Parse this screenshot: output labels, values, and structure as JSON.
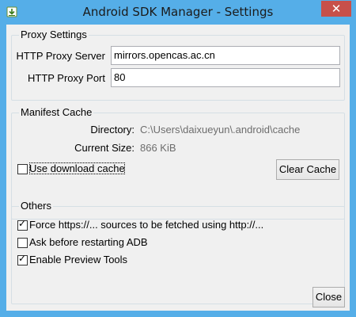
{
  "window": {
    "title": "Android SDK Manager - Settings",
    "close_glyph": "✕"
  },
  "proxy": {
    "group_title": "Proxy Settings",
    "server_label": "HTTP Proxy Server",
    "server_value": "mirrors.opencas.ac.cn",
    "port_label": "HTTP Proxy Port",
    "port_value": "80"
  },
  "manifest": {
    "group_title": "Manifest Cache",
    "directory_label": "Directory:",
    "directory_value": "C:\\Users\\daixueyun\\.android\\cache",
    "size_label": "Current Size:",
    "size_value": "866 KiB",
    "use_cache_label": "Use download cache",
    "use_cache_checked": false,
    "clear_button": "Clear Cache"
  },
  "others": {
    "group_title": "Others",
    "options": [
      {
        "label": "Force https://... sources to be fetched using http://...",
        "checked": true
      },
      {
        "label": "Ask before restarting ADB",
        "checked": false
      },
      {
        "label": "Enable Preview Tools",
        "checked": true
      }
    ]
  },
  "footer": {
    "close_button": "Close"
  },
  "colors": {
    "titlebar": "#55aee8",
    "close_button_bg": "#c7504a",
    "client_bg": "#f0f0f0"
  },
  "icons": {
    "app": "android-sdk-download-icon",
    "check": "check-icon"
  }
}
